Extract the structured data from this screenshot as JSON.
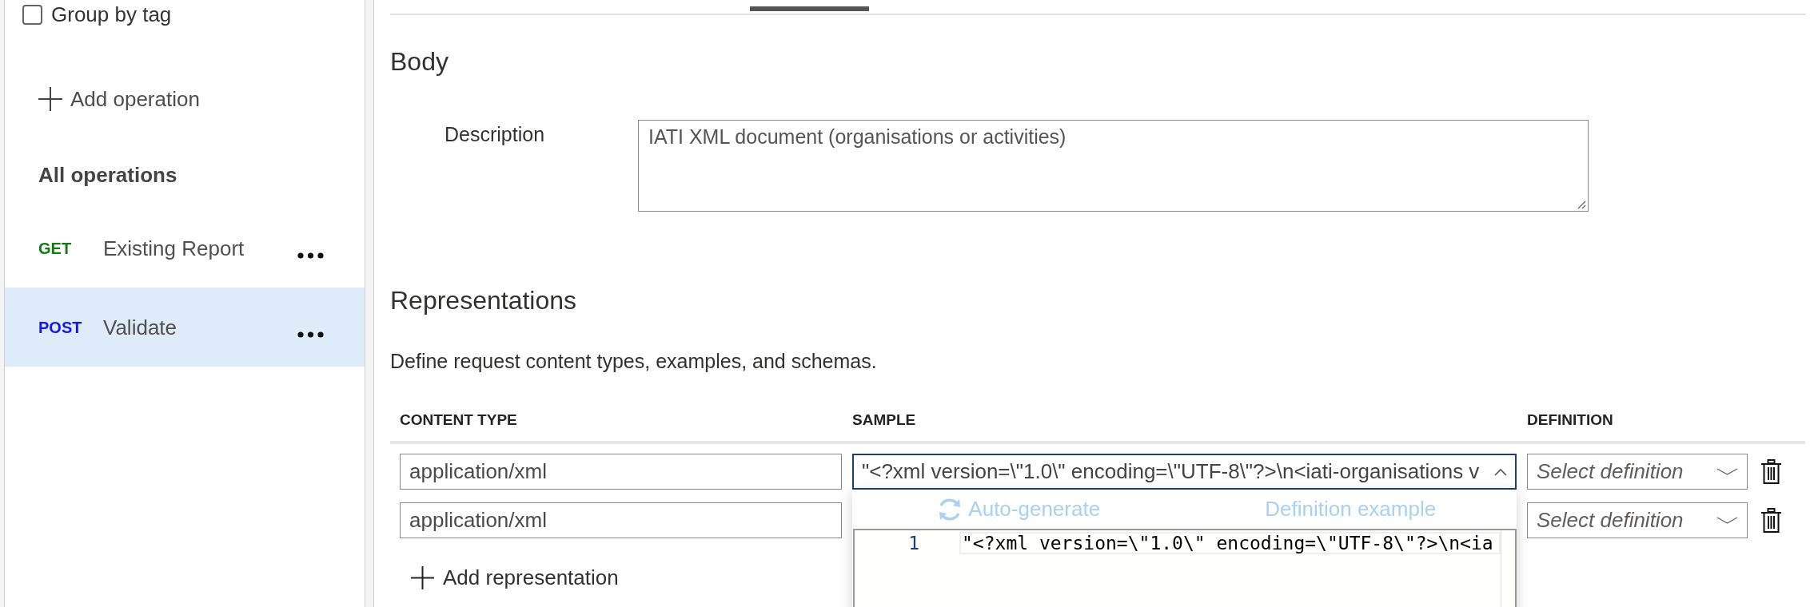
{
  "sidebar": {
    "group_by_tag": {
      "label": "Group by tag",
      "checked": false
    },
    "add_operation": "Add operation",
    "all_operations": "All operations",
    "operations": [
      {
        "method": "GET",
        "color": "#107c10",
        "name": "Existing Report",
        "selected": false
      },
      {
        "method": "POST",
        "color": "#1414f0",
        "name": "Validate",
        "selected": true
      }
    ]
  },
  "body": {
    "title": "Body",
    "description": {
      "label": "Description",
      "value": "IATI XML document (organisations or activities)"
    }
  },
  "representations": {
    "title": "Representations",
    "subtitle": "Define request content types, examples, and schemas.",
    "columns": [
      "CONTENT TYPE",
      "SAMPLE",
      "DEFINITION"
    ],
    "rows": [
      {
        "content_type": "application/xml",
        "sample": {
          "value": "\"<?xml version=\\\"1.0\\\" encoding=\\\"UTF-8\\\"?>\\n<iati-organisations v",
          "focused": true
        },
        "definition": {
          "placeholder": "Select definition"
        }
      },
      {
        "content_type": "application/xml",
        "definition": {
          "placeholder": "Select definition"
        }
      }
    ],
    "sample_popup": {
      "actions": [
        {
          "label": "Auto-generate",
          "kind": "generate",
          "disabled": true
        },
        {
          "label": "Definition example",
          "kind": "example",
          "disabled": true
        }
      ],
      "editor_lines": [
        {
          "number": "1",
          "code": "\"<?xml version=\\\"1.0\\\" encoding=\\\"UTF-8\\\"?>\\n<ia"
        }
      ]
    },
    "add_representation": "Add representation"
  }
}
